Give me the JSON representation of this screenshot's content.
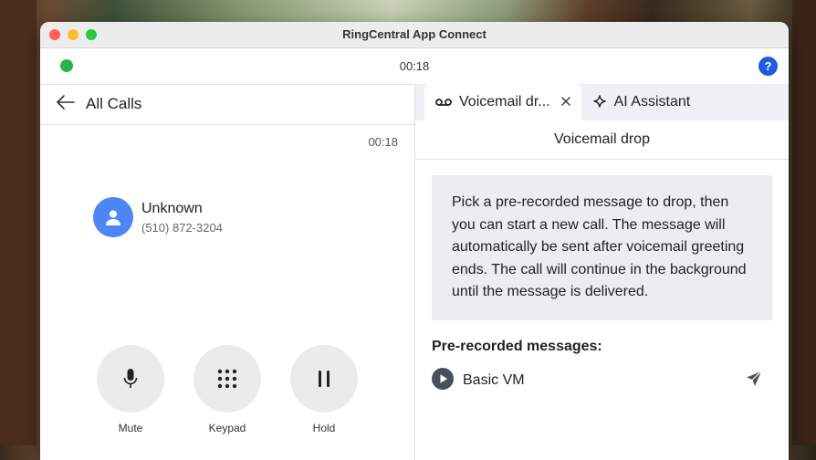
{
  "window": {
    "title": "RingCentral App Connect"
  },
  "status": {
    "timer": "00:18",
    "help_label": "?"
  },
  "call": {
    "back_label": "All Calls",
    "timer": "00:18",
    "contact_name": "Unknown",
    "contact_phone": "(510) 872-3204"
  },
  "controls": [
    {
      "label": "Mute",
      "icon": "microphone-icon"
    },
    {
      "label": "Keypad",
      "icon": "keypad-icon"
    },
    {
      "label": "Hold",
      "icon": "pause-icon"
    }
  ],
  "tabs": [
    {
      "label": "Voicemail dr...",
      "icon": "voicemail-icon",
      "active": true
    },
    {
      "label": "AI Assistant",
      "icon": "sparkle-icon",
      "active": false
    }
  ],
  "voicemail": {
    "title": "Voicemail drop",
    "info": "Pick a pre-recorded message to drop, then you can start a new call. The message will automatically be sent after voicemail greeting ends. The call will continue in the background until the message is delivered.",
    "section_label": "Pre-recorded messages:",
    "messages": [
      {
        "label": "Basic VM"
      }
    ]
  },
  "colors": {
    "online": "#2bb24c",
    "help": "#1f5be0",
    "avatar": "#4d86f5"
  }
}
